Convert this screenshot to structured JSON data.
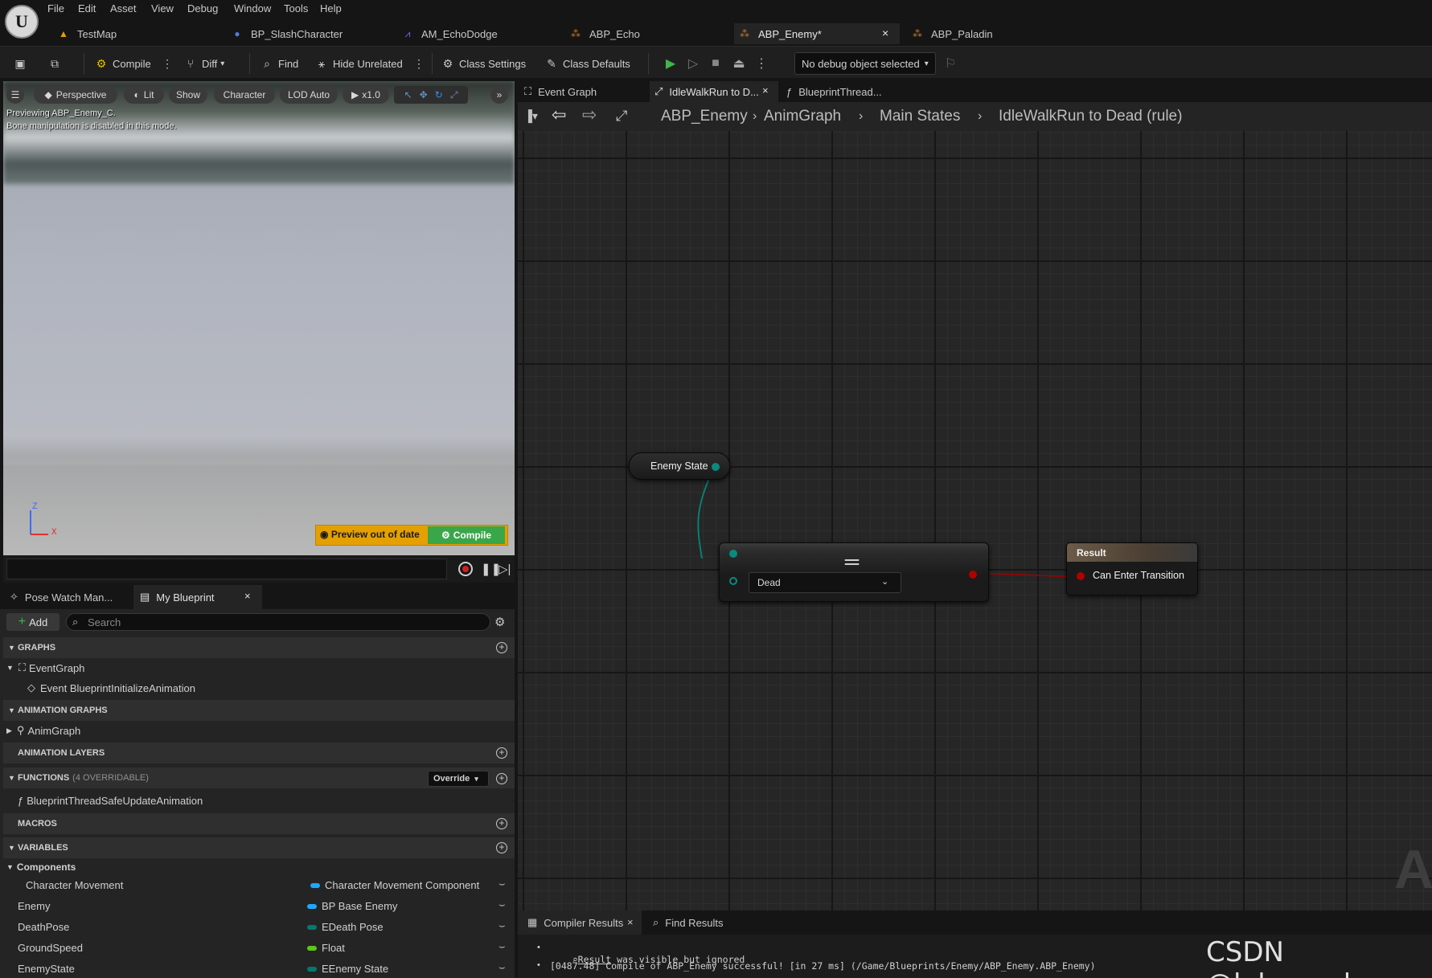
{
  "menu": [
    "File",
    "Edit",
    "Asset",
    "View",
    "Debug",
    "Window",
    "Tools",
    "Help"
  ],
  "asset_tabs": [
    {
      "label": "TestMap",
      "icon": "map-icon"
    },
    {
      "label": "BP_SlashCharacter",
      "icon": "character-blueprint-icon"
    },
    {
      "label": "AM_EchoDodge",
      "icon": "anim-montage-icon"
    },
    {
      "label": "ABP_Echo",
      "icon": "anim-blueprint-icon"
    },
    {
      "label": "ABP_Enemy*",
      "icon": "anim-blueprint-icon",
      "active": true,
      "close": "×"
    },
    {
      "label": "ABP_Paladin",
      "icon": "anim-blueprint-icon"
    }
  ],
  "toolbar": {
    "compile": "Compile",
    "diff": "Diff",
    "find": "Find",
    "hide_unrelated": "Hide Unrelated",
    "class_settings": "Class Settings",
    "class_defaults": "Class Defaults",
    "debug_object": "No debug object selected"
  },
  "viewport": {
    "perspective": "Perspective",
    "lit": "Lit",
    "show": "Show",
    "character": "Character",
    "lod": "LOD Auto",
    "speed": "x1.0",
    "preview_line1": "Previewing ABP_Enemy_C.",
    "preview_line2": "Bone manipulation is disabled in this mode.",
    "axis_z": "Z",
    "axis_x": "X",
    "preview_out_of_date": "Preview out of date",
    "compile": "Compile"
  },
  "panel_tabs": {
    "pose_watch": "Pose Watch Man...",
    "my_blueprint": "My Blueprint",
    "close": "×"
  },
  "my_blueprint": {
    "add": "Add",
    "search_placeholder": "Search",
    "graphs_header": "GRAPHS",
    "event_graph": "EventGraph",
    "event_init": "Event BlueprintInitializeAnimation",
    "anim_graphs_header": "ANIMATION GRAPHS",
    "anim_graph": "AnimGraph",
    "anim_layers_header": "ANIMATION LAYERS",
    "functions_header": "FUNCTIONS",
    "functions_count": "(4 OVERRIDABLE)",
    "override": "Override",
    "function_1": "BlueprintThreadSafeUpdateAnimation",
    "macros_header": "MACROS",
    "variables_header": "VARIABLES",
    "components_header": "Components",
    "variables": [
      {
        "name": "Character Movement",
        "type": "Character Movement Component",
        "color": "#1ea7ff"
      },
      {
        "name": "Enemy",
        "type": "BP Base Enemy",
        "color": "#1ea7ff"
      },
      {
        "name": "DeathPose",
        "type": "EDeath Pose",
        "color": "#007a6e"
      },
      {
        "name": "GroundSpeed",
        "type": "Float",
        "color": "#5ec51b"
      },
      {
        "name": "EnemyState",
        "type": "EEnemy State",
        "color": "#007a6e"
      }
    ]
  },
  "graph_tabs": {
    "event_graph": "Event Graph",
    "idle": "IdleWalkRun to D...",
    "thread": "BlueprintThread...",
    "close": "×"
  },
  "breadcrumb": [
    "ABP_Enemy",
    "AnimGraph",
    "Main States",
    "IdleWalkRun to Dead (rule)"
  ],
  "graph": {
    "enemy_state_node": "Enemy State",
    "equals_glyph": "==",
    "dropdown_value": "Dead",
    "result_title": "Result",
    "result_pin": "Can Enter Transition",
    "ghost_label": "AI"
  },
  "compiler": {
    "tab_results": "Compiler Results",
    "tab_find": "Find Results",
    "close": "×",
    "log_1_link": "Result",
    "log_1_text": " was visible but ignored",
    "log_2": "[0487.48] Compile of ABP_Enemy successful! [in 27 ms] (/Game/Blueprints/Enemy/ABP_Enemy.ABP_Enemy)"
  },
  "watermark": "CSDN @lalapanda",
  "colors": {
    "enum_pin": "#007a6e",
    "bool_pin": "#aa0000",
    "object_pin": "#1ea7ff",
    "float_pin": "#5ec51b",
    "warning": "#e4a000",
    "compile_green": "#39a64a"
  }
}
